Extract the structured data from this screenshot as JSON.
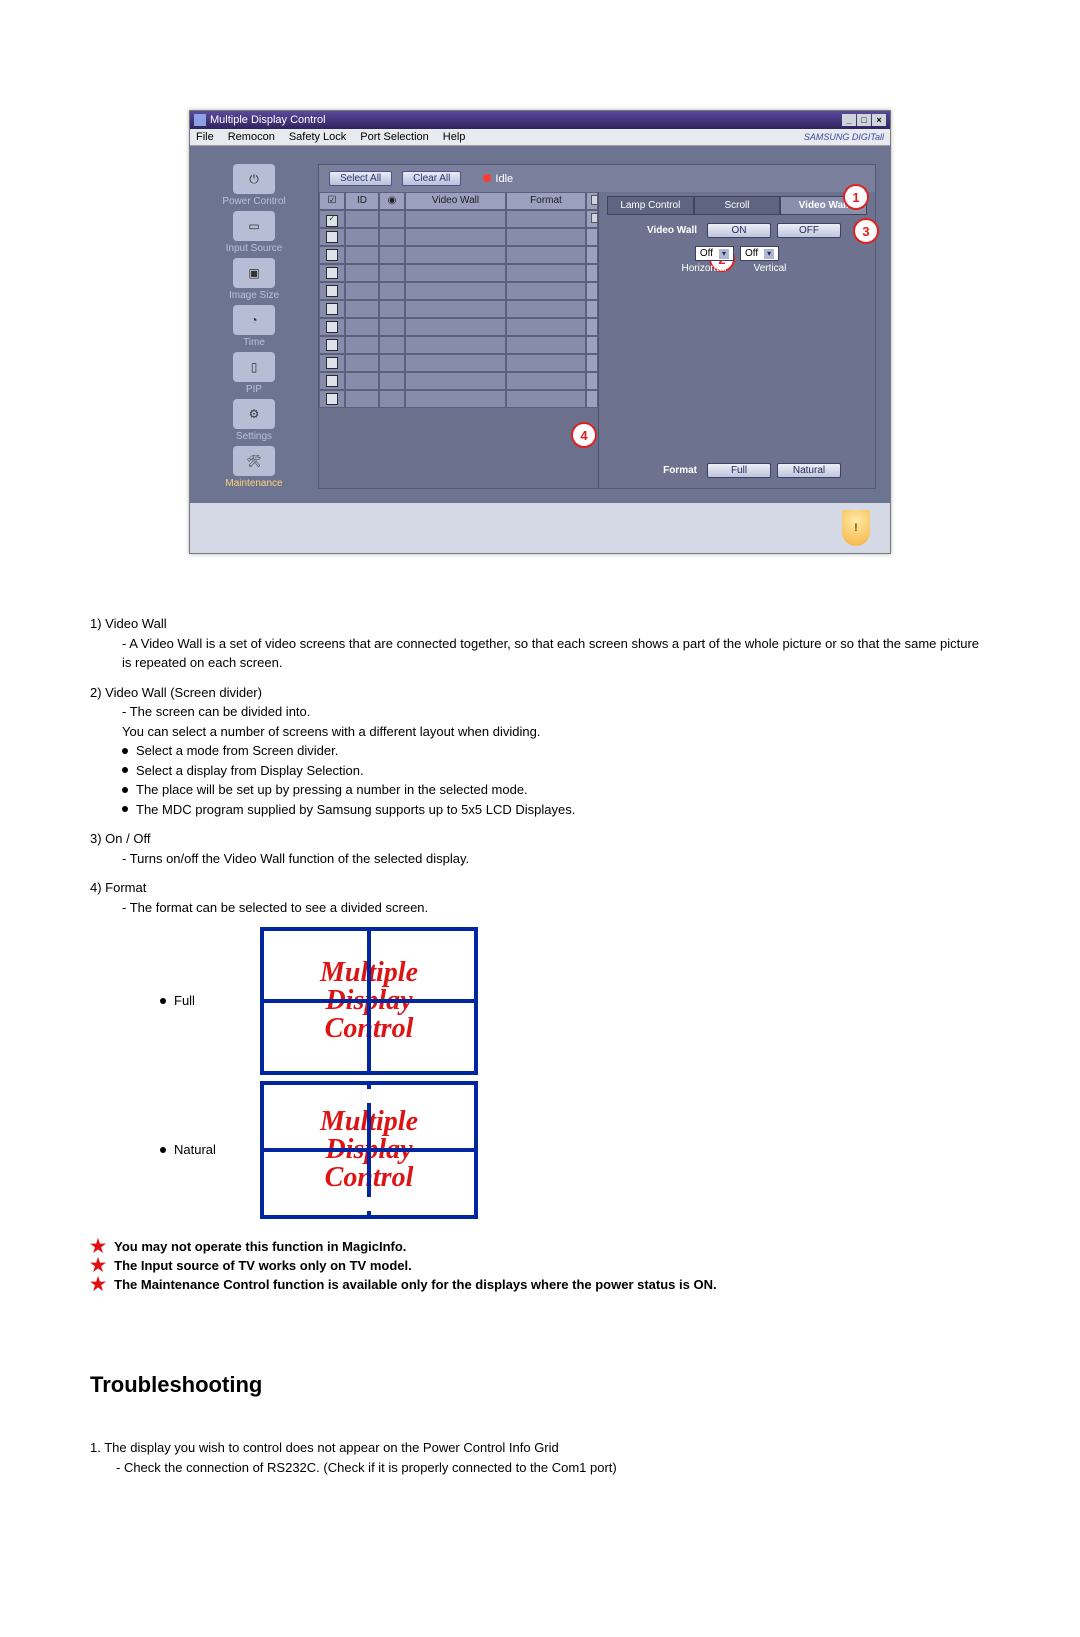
{
  "window": {
    "title": "Multiple Display Control",
    "menus": [
      "File",
      "Remocon",
      "Safety Lock",
      "Port Selection",
      "Help"
    ],
    "brand": "SAMSUNG DIGITall"
  },
  "sidebar": {
    "items": [
      {
        "label": "Power Control"
      },
      {
        "label": "Input Source"
      },
      {
        "label": "Image Size"
      },
      {
        "label": "Time"
      },
      {
        "label": "PIP"
      },
      {
        "label": "Settings"
      },
      {
        "label": "Maintenance"
      }
    ]
  },
  "toolbar": {
    "select_all": "Select All",
    "clear_all": "Clear All",
    "idle": "Idle"
  },
  "grid": {
    "columns": {
      "chk": "",
      "id": "ID",
      "stat": "",
      "vw": "Video Wall",
      "fmt": "Format"
    }
  },
  "tabs": {
    "lamp": "Lamp Control",
    "scroll": "Scroll",
    "videowall": "Video Wall"
  },
  "panel": {
    "vw_label": "Video Wall",
    "on": "ON",
    "off": "OFF",
    "h_label": "Horizontal",
    "v_label": "Vertical",
    "h_val": "Off",
    "v_val": "Off",
    "fmt_label": "Format",
    "full": "Full",
    "natural": "Natural"
  },
  "callouts": {
    "c1": "1",
    "c2": "2",
    "c3": "3",
    "c4": "4"
  },
  "explain": {
    "i1_t": "1)  Video Wall",
    "i1_a": "- A Video Wall is a set of video screens that are connected together, so that each screen shows a part of the whole picture or so that the same picture is repeated on each screen.",
    "i2_t": "2)  Video Wall (Screen divider)",
    "i2_a": "- The screen can be divided into.",
    "i2_b": "You can select a number of screens with a different layout when dividing.",
    "i2_c": "Select a mode from Screen divider.",
    "i2_d": "Select a display from Display Selection.",
    "i2_e": "The place will be set up by pressing a number in the selected mode.",
    "i2_f": "The MDC program supplied by Samsung supports up to 5x5 LCD Displayes.",
    "i3_t": "3)  On / Off",
    "i3_a": "- Turns on/off the Video Wall function of the selected display.",
    "i4_t": "4)  Format",
    "i4_a": "- The format can be selected to see a divided screen.",
    "full": "Full",
    "natural": "Natural"
  },
  "preview_text": {
    "l1": "Multiple",
    "l2": "Display",
    "l3": "Control"
  },
  "notes": {
    "n1": "You may not operate this function in MagicInfo.",
    "n2": "The Input source of TV works only on TV model.",
    "n3": "The Maintenance Control function is available only for the displays where the power status is ON."
  },
  "section": {
    "title": "Troubleshooting"
  },
  "ts": {
    "t1": "1. The display you wish to control does not appear on the Power Control Info Grid",
    "t1a": "- Check the connection of RS232C. (Check if it is properly connected to the Com1 port)"
  }
}
